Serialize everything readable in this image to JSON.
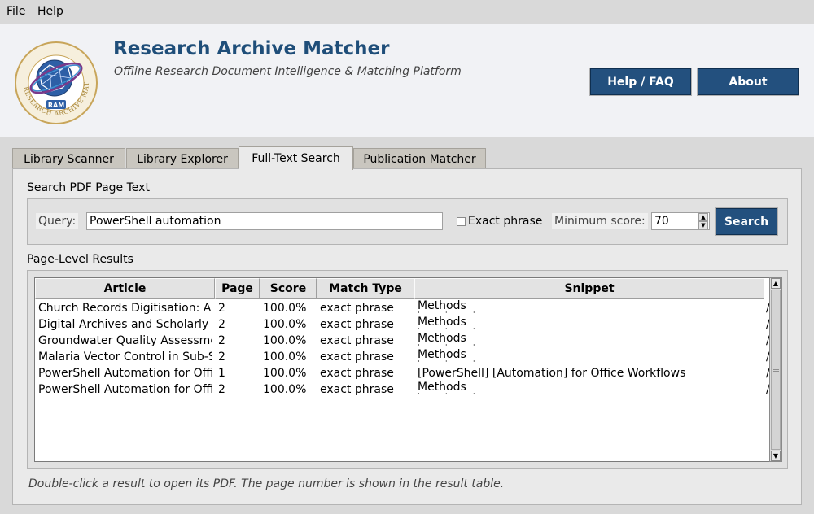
{
  "menubar": {
    "file": "File",
    "help": "Help"
  },
  "header": {
    "logo_text": "RAM",
    "logo_ring_text": "RESEARCH ARCHIVE MATCHER",
    "title": "Research Archive Matcher",
    "subtitle": "Offline Research Document Intelligence & Matching Platform",
    "help_button": "Help / FAQ",
    "about_button": "About",
    "accent_color": "#23507e"
  },
  "tabs": [
    {
      "label": "Library Scanner"
    },
    {
      "label": "Library Explorer"
    },
    {
      "label": "Full-Text Search"
    },
    {
      "label": "Publication Matcher"
    }
  ],
  "active_tab": "Full-Text Search",
  "search": {
    "section_title": "Search PDF Page Text",
    "query_label": "Query:",
    "query_value": "PowerShell automation",
    "exact_phrase_label": "Exact phrase",
    "exact_phrase_checked": false,
    "min_score_label": "Minimum score:",
    "min_score_value": "70",
    "search_button": "Search"
  },
  "results": {
    "section_title": "Page-Level Results",
    "columns": [
      "Article",
      "Page",
      "Score",
      "Match Type",
      "Snippet"
    ],
    "rows": [
      {
        "article": "Church Records Digitisation: A",
        "page": "2",
        "score": "100.0%",
        "match_type": "exact phrase",
        "snippet": "Methods",
        "tail": "/"
      },
      {
        "article": "Digital Archives and Scholarly",
        "page": "2",
        "score": "100.0%",
        "match_type": "exact phrase",
        "snippet": "Methods",
        "tail": "/"
      },
      {
        "article": "Groundwater Quality Assessme",
        "page": "2",
        "score": "100.0%",
        "match_type": "exact phrase",
        "snippet": "Methods",
        "tail": "/"
      },
      {
        "article": "Malaria Vector Control in Sub-S",
        "page": "2",
        "score": "100.0%",
        "match_type": "exact phrase",
        "snippet": "Methods",
        "tail": "/"
      },
      {
        "article": "PowerShell Automation for Offi",
        "page": "1",
        "score": "100.0%",
        "match_type": "exact phrase",
        "snippet": "[PowerShell] [Automation] for Office Workflows",
        "tail": "/"
      },
      {
        "article": "PowerShell Automation for Offi",
        "page": "2",
        "score": "100.0%",
        "match_type": "exact phrase",
        "snippet": "Methods",
        "tail": "/"
      }
    ]
  },
  "footer_note": "Double-click a result to open its PDF. The page number is shown in the result table."
}
